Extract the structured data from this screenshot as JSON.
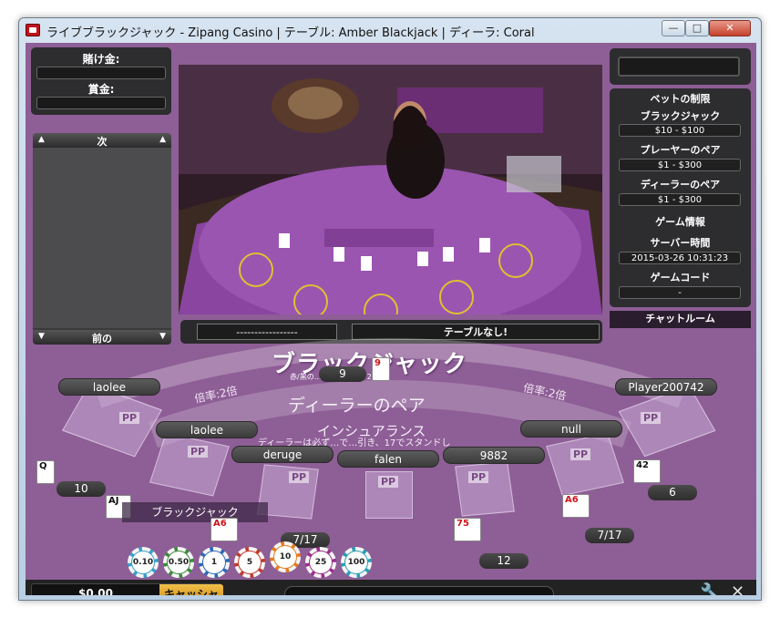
{
  "window": {
    "title": "ライブブラックジャック - Zipang Casino | テーブル: Amber  Blackjack | ディーラ: Coral",
    "minimize": "—",
    "maximize": "□",
    "close": "✕"
  },
  "left_panel": {
    "bet_label": "賭け金:",
    "bet_value": "",
    "prize_label": "賞金:",
    "prize_value": "",
    "next_label": "次",
    "prev_label": "前の"
  },
  "video_bar": {
    "left_text": "-----------------",
    "right_text": "テーブルなし!"
  },
  "right_panel": {
    "top_field": "",
    "bet_limits_title": "ベットの制限",
    "blackjack_label": "ブラックジャック",
    "blackjack_value": "$10 - $100",
    "player_pair_label": "プレーヤーのペア",
    "player_pair_value": "$1 - $300",
    "dealer_pair_label": "ディーラーのペア",
    "dealer_pair_value": "$1 - $300",
    "game_info_title": "ゲーム情報",
    "server_time_label": "サーバー時間",
    "server_time_value": "2015-03-26 10:31:23",
    "game_code_label": "ゲームコード",
    "game_code_value": "-",
    "chat_room": "チャットルーム"
  },
  "table": {
    "logo": "ブラックジャック",
    "logo_sub": "赤/黒の…                       パーフェクト25倍",
    "payout_left": "倍率:2倍",
    "payout_right": "倍率:2倍",
    "dealer_pair": "ディーラーのペア",
    "insurance": "インシュアランス",
    "rule_text": "ディーラーは必ず…で…引き、17でスタンドし",
    "pp": "PP",
    "dealer_score": "9",
    "dealer_card": "9",
    "blackjack_banner": "ブラックジャック"
  },
  "seats": [
    {
      "name": "laolee"
    },
    {
      "name": "laolee"
    },
    {
      "name": "deruge"
    },
    {
      "name": "falen"
    },
    {
      "name": "9882"
    },
    {
      "name": "null"
    },
    {
      "name": "Player200742"
    }
  ],
  "hands": {
    "s1_score": "10",
    "s1_card": "Q",
    "s2_card": "AJ",
    "s3_score": "7/17",
    "s3_card": "A6",
    "s5_score": "12",
    "s5_card": "75",
    "s6_score": "7/17",
    "s6_card": "A6",
    "s7_score": "6",
    "s7_card": "42"
  },
  "chips": [
    {
      "label": "0.10",
      "color": "#3a9ec7"
    },
    {
      "label": "0.50",
      "color": "#3c8a3c"
    },
    {
      "label": "1",
      "color": "#2e69b5"
    },
    {
      "label": "5",
      "color": "#c23a2d"
    },
    {
      "label": "10",
      "color": "#e37b22"
    },
    {
      "label": "25",
      "color": "#9b2f8c"
    },
    {
      "label": "100",
      "color": "#2a9eb4"
    }
  ],
  "bottom": {
    "balance": "$0.00",
    "cashier": "キャッシャー",
    "status": ""
  },
  "colors": {
    "felt": "#8e5e96",
    "cashier": "#e3a51f",
    "panel": "#2d2d30"
  }
}
